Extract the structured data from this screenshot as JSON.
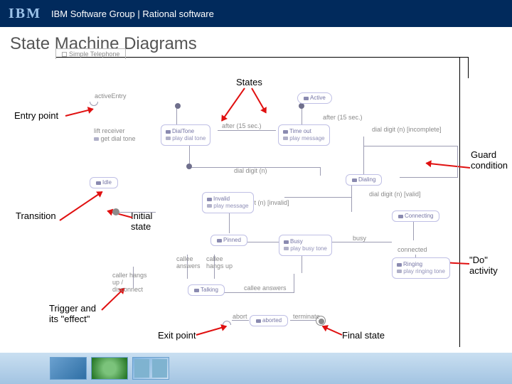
{
  "header": {
    "logo": "IBM",
    "breadcrumb": "IBM Software Group | Rational software"
  },
  "title": "State Machine Diagrams",
  "tab_label": "Simple Telephone",
  "annotations": {
    "states": "States",
    "entry_point": "Entry point",
    "guard": "Guard condition",
    "transition": "Transition",
    "initial_state": "Initial state",
    "do_activity": "\"Do\" activity",
    "trigger": "Trigger and its \"effect\"",
    "exit_point": "Exit point",
    "final_state": "Final state"
  },
  "diagram": {
    "entry_label": "activeEntry",
    "active_state": "Active",
    "idle": {
      "name": "Idle",
      "lift": "lift receiver",
      "get": "get dial tone"
    },
    "dial_tone": {
      "name": "DialTone",
      "do": "play dial tone"
    },
    "time_out": {
      "name": "Time out",
      "do": "play message"
    },
    "dialing": {
      "name": "Dialing"
    },
    "invalid": {
      "name": "Invalid",
      "do": "play message"
    },
    "pinned": {
      "name": "Pinned"
    },
    "busy": {
      "name": "Busy",
      "do": "play busy tone"
    },
    "connecting": {
      "name": "Connecting"
    },
    "ringing": {
      "name": "Ringing",
      "do": "play ringing tone"
    },
    "talking": {
      "name": "Talking"
    },
    "aborted": {
      "name": "aborted"
    },
    "text": {
      "after15": "after (15 sec.)",
      "after15b": "after (15 sec.)",
      "guard": "dial digit (n) [incomplete]",
      "dial_n": "dial digit (n)",
      "dial_valid": "dial digit (n) [valid]",
      "dial_invalid": "dial digit (n) [invalid]",
      "callee_answers": "callee answers",
      "callee_hangup": "callee hangs up",
      "caller_hangup": "caller hangs up / disconnect",
      "busy_txt": "busy",
      "connected": "connected",
      "callee_answers2": "callee answers",
      "abort": "abort",
      "terminate": "terminate"
    }
  }
}
